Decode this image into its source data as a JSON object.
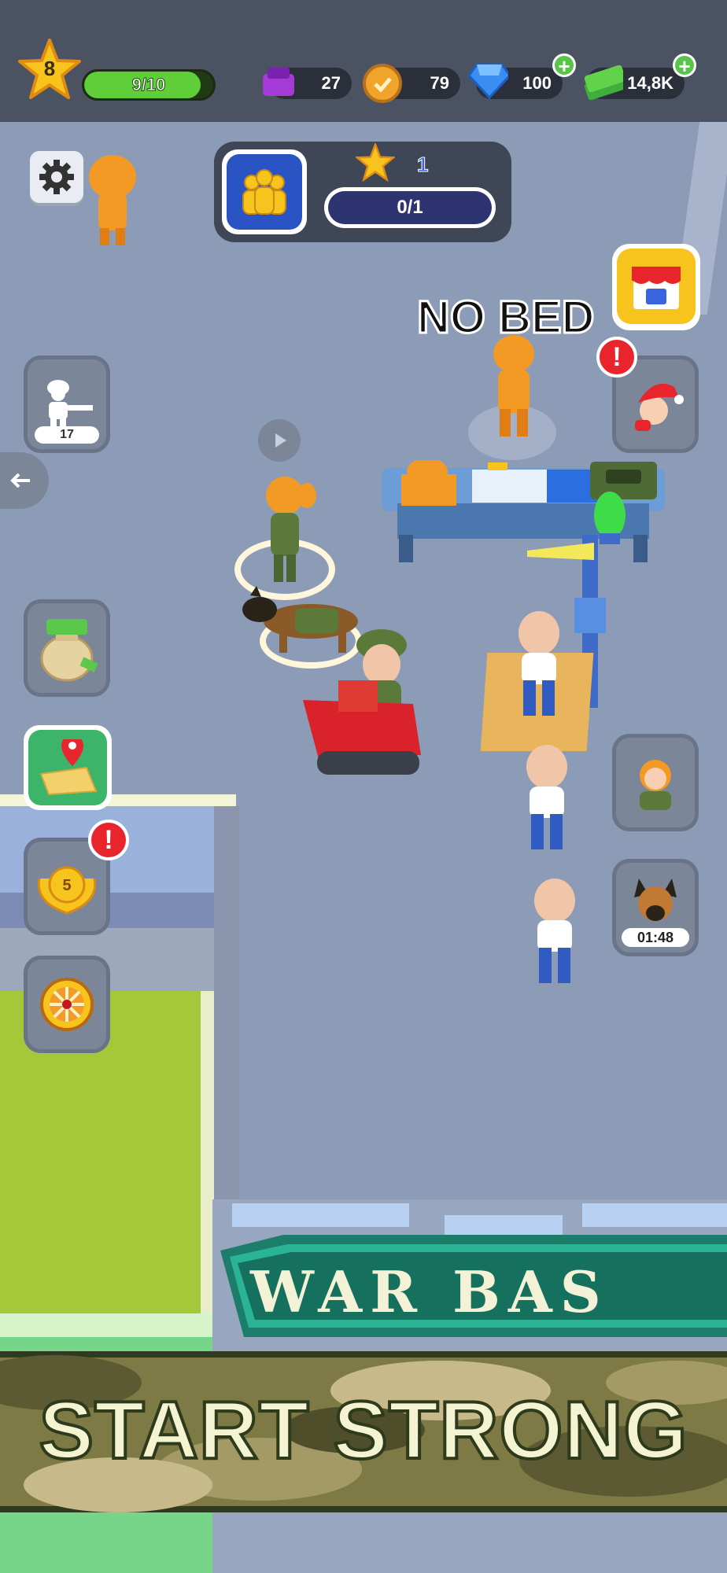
{
  "hud": {
    "level": "8",
    "xp_progress": "9/10",
    "xp_fraction": 0.9,
    "tickets": "27",
    "coins": "79",
    "gems": "100",
    "cash": "14,8K"
  },
  "objective": {
    "stars": "1",
    "progress": "0/1",
    "progress_fraction": 0.0
  },
  "world": {
    "no_bed_label": "NO BED",
    "war_base_sign": "WAR BAS"
  },
  "side_left": {
    "soldier_count": "17",
    "badge_level": "5"
  },
  "side_right": {
    "dog_timer": "01:48"
  },
  "banner": {
    "text": "START STRONG"
  },
  "colors": {
    "accent_green": "#58c44a",
    "alert_red": "#e8242c",
    "star_yellow": "#f7c31d",
    "prisoner_orange": "#f39a25",
    "camo_dark": "#5b5a33"
  }
}
